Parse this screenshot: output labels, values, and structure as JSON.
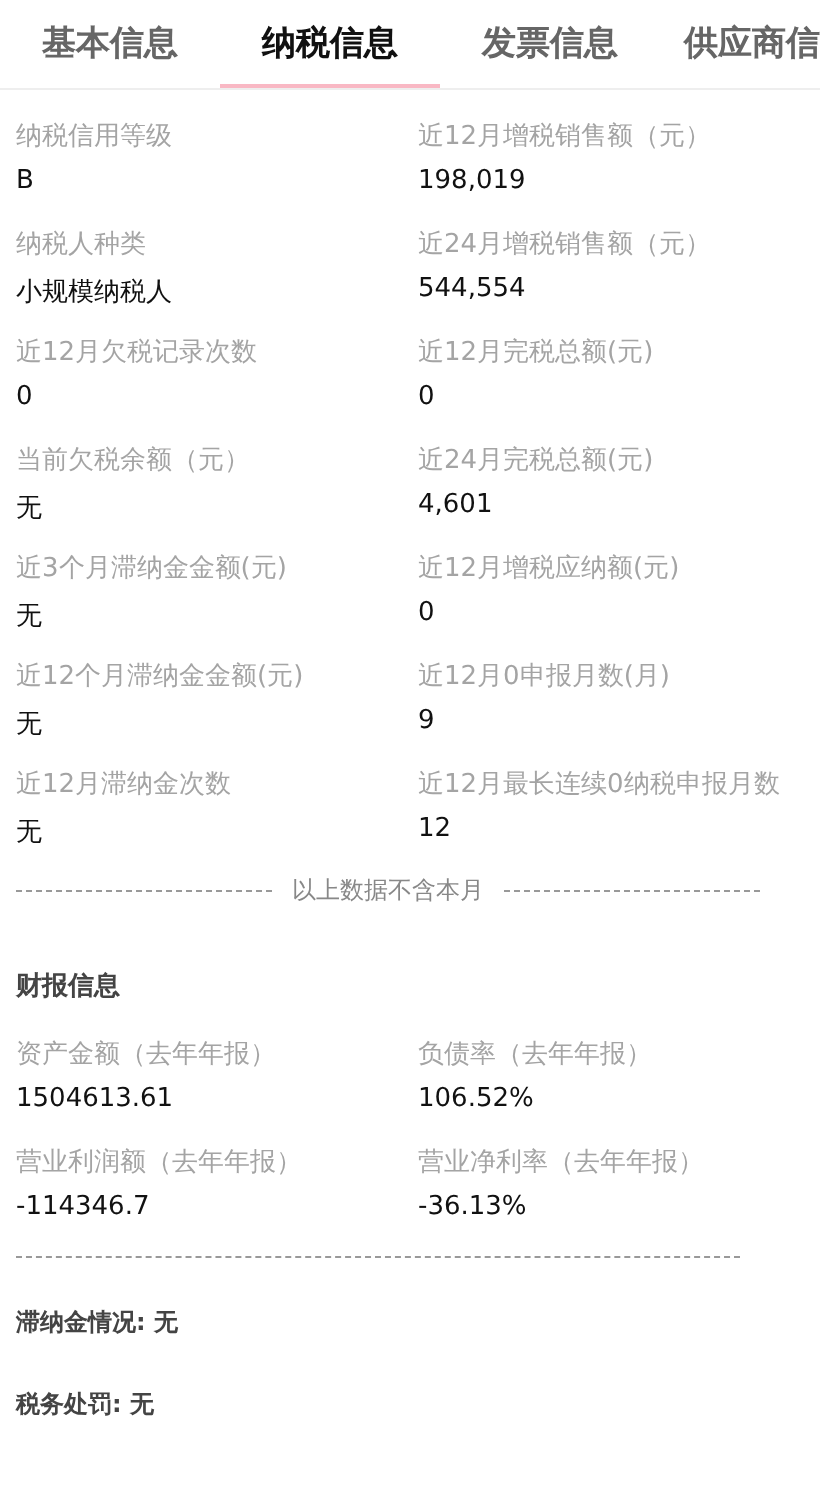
{
  "tabs": [
    {
      "label": "基本信息",
      "selected": false
    },
    {
      "label": "纳税信息",
      "selected": true
    },
    {
      "label": "发票信息",
      "selected": false
    },
    {
      "label": "供应商信",
      "selected": false
    }
  ],
  "tax_fields": [
    {
      "label": "纳税信用等级",
      "value": "B"
    },
    {
      "label": "近12月增税销售额（元）",
      "value": "198,019"
    },
    {
      "label": "纳税人种类",
      "value": "小规模纳税人"
    },
    {
      "label": "近24月增税销售额（元）",
      "value": "544,554"
    },
    {
      "label": "近12月欠税记录次数",
      "value": "0"
    },
    {
      "label": "近12月完税总额(元)",
      "value": "0"
    },
    {
      "label": "当前欠税余额（元）",
      "value": "无"
    },
    {
      "label": "近24月完税总额(元)",
      "value": "4,601"
    },
    {
      "label": "近3个月滞纳金金额(元)",
      "value": "无"
    },
    {
      "label": "近12月增税应纳额(元)",
      "value": "0"
    },
    {
      "label": "近12个月滞纳金金额(元)",
      "value": "无"
    },
    {
      "label": "近12月0申报月数(月)",
      "value": "9"
    },
    {
      "label": "近12月滞纳金次数",
      "value": "无"
    },
    {
      "label": "近12月最长连续0纳税申报月数",
      "value": "12"
    }
  ],
  "note": "以上数据不含本月",
  "financial": {
    "title": "财报信息",
    "fields": [
      {
        "label": "资产金额（去年年报）",
        "value": "1504613.61"
      },
      {
        "label": "负债率（去年年报）",
        "value": "106.52%"
      },
      {
        "label": "营业利润额（去年年报）",
        "value": "-114346.7"
      },
      {
        "label": "营业净利率（去年年报）",
        "value": "-36.13%"
      }
    ]
  },
  "summary": [
    "滞纳金情况: 无",
    "税务处罚: 无"
  ]
}
